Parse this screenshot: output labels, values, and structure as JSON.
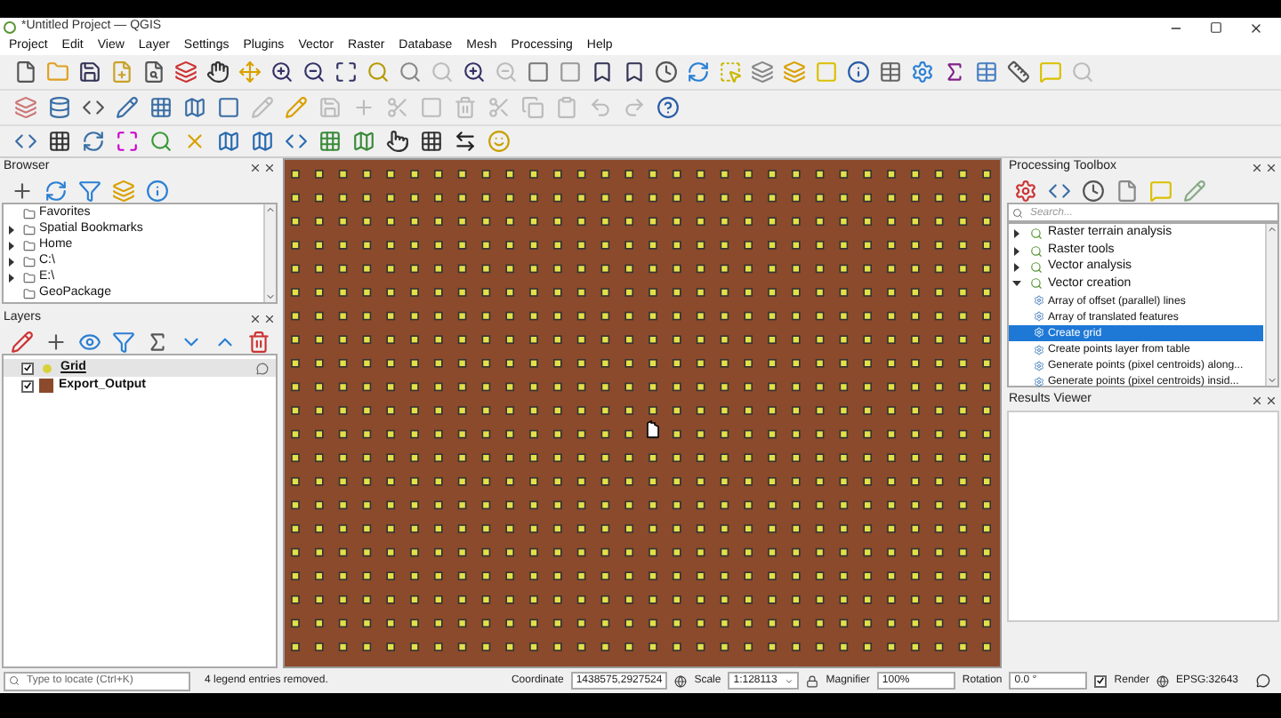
{
  "window": {
    "title": "*Untitled Project — QGIS"
  },
  "menu": [
    "Project",
    "Edit",
    "View",
    "Layer",
    "Settings",
    "Plugins",
    "Vector",
    "Raster",
    "Database",
    "Mesh",
    "Processing",
    "Help"
  ],
  "browser": {
    "title": "Browser",
    "items": [
      {
        "label": "Favorites",
        "expandable": false
      },
      {
        "label": "Spatial Bookmarks",
        "expandable": true
      },
      {
        "label": "Home",
        "expandable": true
      },
      {
        "label": "C:\\",
        "expandable": true
      },
      {
        "label": "E:\\",
        "expandable": true
      },
      {
        "label": "GeoPackage",
        "expandable": false
      }
    ]
  },
  "layers": {
    "title": "Layers",
    "items": [
      {
        "label": "Grid",
        "checked": true,
        "selected": true,
        "kind": "point",
        "color": "#d8d23a"
      },
      {
        "label": "Export_Output",
        "checked": true,
        "selected": false,
        "kind": "polygon",
        "color": "#8b4a2b"
      }
    ]
  },
  "toolbox": {
    "title": "Processing Toolbox",
    "search": {
      "placeholder": "Search..."
    },
    "items": [
      {
        "label": "Raster terrain analysis",
        "expanded": false
      },
      {
        "label": "Raster tools",
        "expanded": false
      },
      {
        "label": "Vector analysis",
        "expanded": false
      },
      {
        "label": "Vector creation",
        "expanded": true,
        "children": [
          {
            "label": "Array of offset (parallel) lines",
            "selected": false
          },
          {
            "label": "Array of translated features",
            "selected": false
          },
          {
            "label": "Create grid",
            "selected": true
          },
          {
            "label": "Create points layer from table",
            "selected": false
          },
          {
            "label": "Generate points (pixel centroids) along...",
            "selected": false
          },
          {
            "label": "Generate points (pixel centroids) insid...",
            "selected": false
          }
        ]
      }
    ]
  },
  "results_viewer": {
    "title": "Results Viewer"
  },
  "status_bar": {
    "locate": {
      "placeholder": "Type to locate (Ctrl+K)"
    },
    "message": "4 legend entries removed.",
    "coordinate_label": "Coordinate",
    "coordinate": "1438575,2927524",
    "scale_label": "Scale",
    "scale": "1:128113",
    "magnifier_label": "Magnifier",
    "magnifier": "100%",
    "rotation_label": "Rotation",
    "rotation": "0.0 °",
    "render_label": "Render",
    "render_checked": true,
    "crs": "EPSG:32643"
  }
}
